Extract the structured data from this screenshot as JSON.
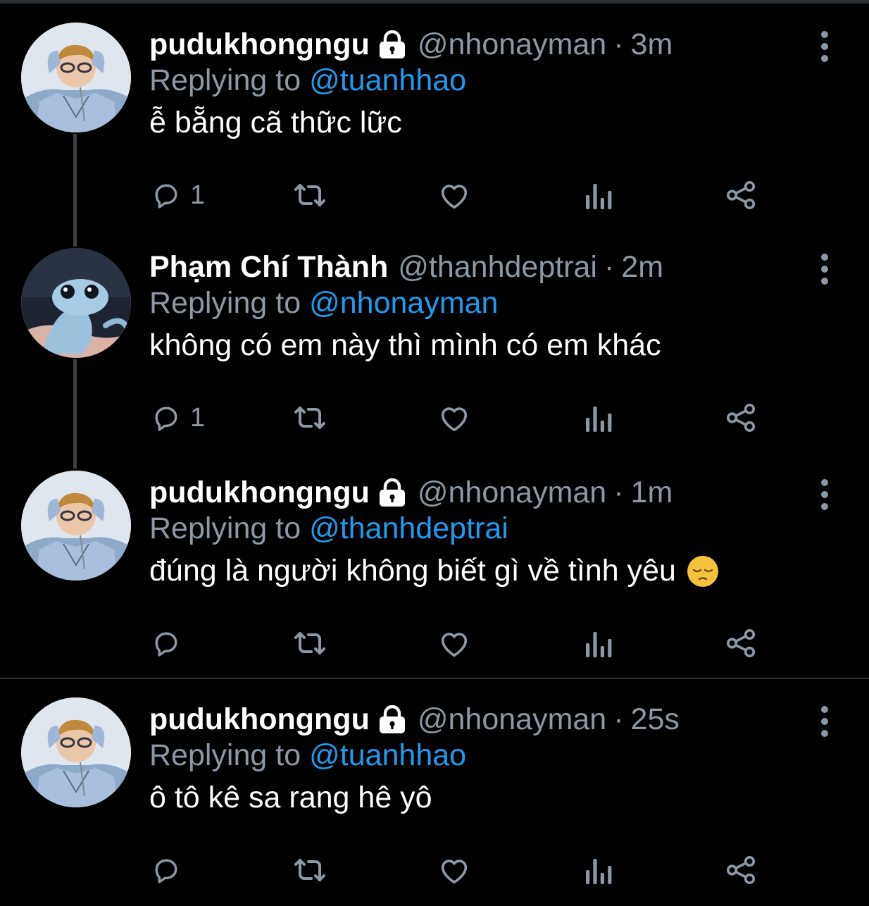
{
  "tweets": [
    {
      "name": "pudukhongngu",
      "locked": true,
      "handle": "@nhonayman",
      "separator": "·",
      "time": "3m",
      "reply_prefix": "Replying to",
      "reply_to": "@tuanhhao",
      "text": "ễ bẵng cã thữc lữc",
      "reply_count": "1",
      "avatar": "person-blue-shirt"
    },
    {
      "name": "Phạm Chí Thành",
      "locked": false,
      "handle": "@thanhdeptrai",
      "separator": "·",
      "time": "2m",
      "reply_prefix": "Replying to",
      "reply_to": "@nhonayman",
      "text": "không có em này thì mình có em khác",
      "reply_count": "1",
      "avatar": "blue-salamander"
    },
    {
      "name": "pudukhongngu",
      "locked": true,
      "handle": "@nhonayman",
      "separator": "·",
      "time": "1m",
      "reply_prefix": "Replying to",
      "reply_to": "@thanhdeptrai",
      "text": "đúng là người không biết gì về tình yêu",
      "emoji": "pensive-face",
      "reply_count": "",
      "avatar": "person-blue-shirt"
    },
    {
      "name": "pudukhongngu",
      "locked": true,
      "handle": "@nhonayman",
      "separator": "·",
      "time": "25s",
      "reply_prefix": "Replying to",
      "reply_to": "@tuanhhao",
      "text": "ô tô kê sa rang hê yô",
      "reply_count": "",
      "avatar": "person-blue-shirt"
    }
  ],
  "colors": {
    "background": "#000000",
    "secondary_text": "#8b98a5",
    "link": "#1d9bf0",
    "thread_line": "#3b4046"
  },
  "icons": [
    "lock-icon",
    "more-options-icon",
    "reply-icon",
    "retweet-icon",
    "like-icon",
    "analytics-icon",
    "share-icon"
  ]
}
